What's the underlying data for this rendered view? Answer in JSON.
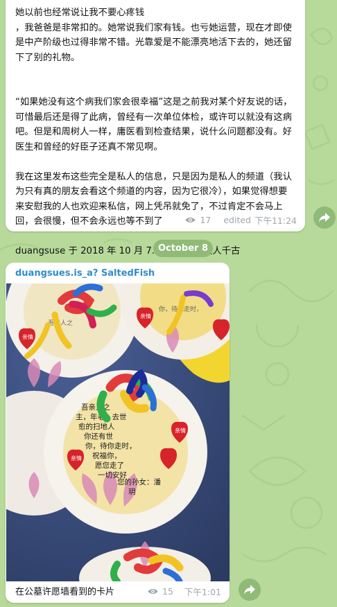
{
  "messages": [
    {
      "text": "她以前也经常说让我不要心疼钱\n，我爸爸是非常扣的。她常说我们家有钱。也亏她运营，现在才即使是中产阶级也过得非常不错。光靠爱是不能漂亮地活下去的，她还留下了别的礼物。\n\n\n“如果她没有这个病我们家会很幸福”这是之前我对某个好友说的话，可惜最后还是得了此病，曾经有一次单位体检，或许可以就没有这病吧。但是和周树人一样，庸医看到检查结果，说什么问题都没有。好医生和曾经的好臣子还真不常见啊。\n\n我在这里发布这些完全是私人的信息，只是因为是私人的频道（我认为只有真的朋友会看这个频道的内容，因为它很冷），如果觉得想要来安慰我的人也欢迎来私信，网上凭吊就免了，不过肯定不会马上回，会很慢，但不会永远也等不到了\n\nduangsuse 于 2018 年 10 月 7..8 日，母上大人千古",
      "views": "17",
      "edited": "edited",
      "time": "下午11:24"
    },
    {
      "sender": "duangsues.is_a? SaltedFish",
      "caption": "在公墓许愿墙看到的卡片",
      "views": "15",
      "time": "下午1:01",
      "photo": {
        "card_heart_label": "亲情",
        "card_handwriting": [
          "吾亲人之",
          "主，年老，去世",
          "愈的扫地人",
          "你还有世",
          "你，待你走时，",
          "祝福你，",
          "愿您走了",
          "一切安好"
        ],
        "card_signature": "您的孙女：潘",
        "card_signature_2": "玥"
      }
    }
  ],
  "date_separator": "October 8",
  "icons": {
    "views": "eye-icon",
    "forward": "share-arrow-icon"
  },
  "colors": {
    "background": "#b7d99a",
    "accent": "#8fba78",
    "sender_name": "#2f8ec8",
    "meta_text": "#a0a6ad",
    "bubble": "#ffffff"
  }
}
